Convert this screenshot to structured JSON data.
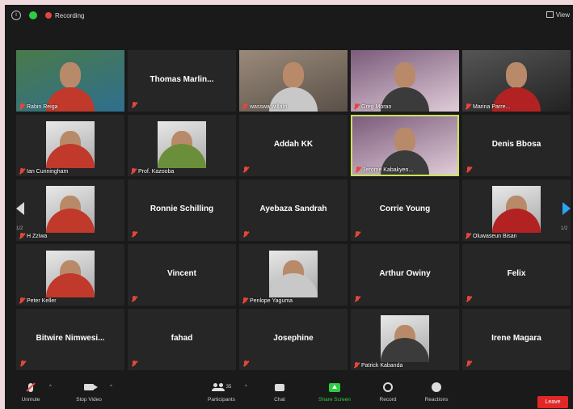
{
  "topbar": {
    "recording_label": "Recording",
    "view_label": "View"
  },
  "participants": [
    {
      "name": "Rabin Reiga",
      "type": "video"
    },
    {
      "name": "Thomas Marlin...",
      "type": "name"
    },
    {
      "name": "wasswa willam",
      "type": "video"
    },
    {
      "name": "Greg Moran",
      "type": "video"
    },
    {
      "name": "Marina Parre...",
      "type": "video"
    },
    {
      "name": "Ian Cunningham",
      "type": "photo"
    },
    {
      "name": "Prof. Kazooba",
      "type": "photo"
    },
    {
      "name": "Addah KK",
      "type": "name"
    },
    {
      "name": "Jerome Kabakyen...",
      "type": "video",
      "active": true
    },
    {
      "name": "Denis Bbosa",
      "type": "name"
    },
    {
      "name": "H Zziwa",
      "type": "photo"
    },
    {
      "name": "Ronnie Schilling",
      "type": "name"
    },
    {
      "name": "Ayebaza Sandrah",
      "type": "name"
    },
    {
      "name": "Corrie Young",
      "type": "name"
    },
    {
      "name": "Oluwaseun Bisan",
      "type": "photo"
    },
    {
      "name": "Peter Keller",
      "type": "photo"
    },
    {
      "name": "Vincent",
      "type": "name"
    },
    {
      "name": "Penlope Yaguma",
      "type": "photo"
    },
    {
      "name": "Arthur Owiny",
      "type": "name"
    },
    {
      "name": "Felix",
      "type": "name"
    },
    {
      "name": "Bitwire Nimwesi...",
      "type": "name"
    },
    {
      "name": "fahad",
      "type": "name"
    },
    {
      "name": "Josephine",
      "type": "name"
    },
    {
      "name": "Patrick Kabanda",
      "type": "photo"
    },
    {
      "name": "Irene Magara",
      "type": "name"
    }
  ],
  "pagination": {
    "left": "1/2",
    "right": "1/2"
  },
  "toolbar": {
    "unmute": "Unmute",
    "stop_video": "Stop Video",
    "participants": "Participants",
    "participants_count": "35",
    "chat": "Chat",
    "share_screen": "Share Screen",
    "record": "Record",
    "reactions": "Reactions",
    "leave": "Leave"
  },
  "colors": {
    "accent_green": "#2ecc40",
    "active_speaker": "#c7e25a",
    "mute_red": "#e8453c",
    "leave_red": "#e02828",
    "arrow_blue": "#2aa4f4"
  }
}
